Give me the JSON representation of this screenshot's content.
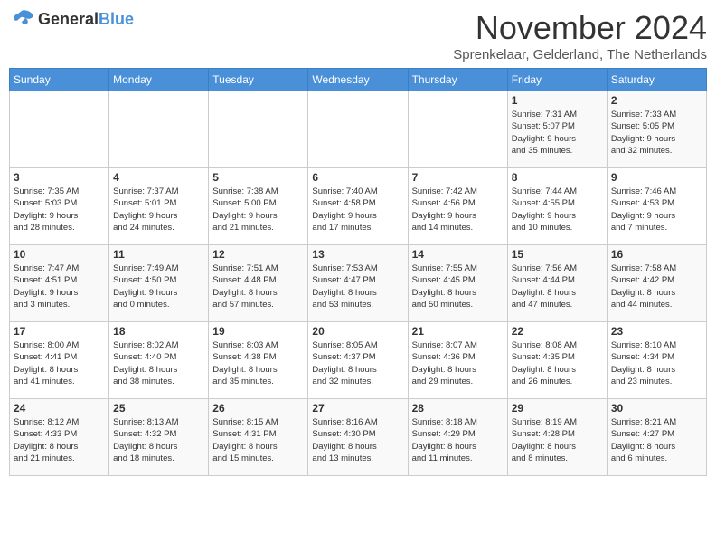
{
  "header": {
    "logo": {
      "general": "General",
      "blue": "Blue"
    },
    "title": "November 2024",
    "subtitle": "Sprenkelaar, Gelderland, The Netherlands"
  },
  "calendar": {
    "days_of_week": [
      "Sunday",
      "Monday",
      "Tuesday",
      "Wednesday",
      "Thursday",
      "Friday",
      "Saturday"
    ],
    "weeks": [
      [
        {
          "day": "",
          "info": ""
        },
        {
          "day": "",
          "info": ""
        },
        {
          "day": "",
          "info": ""
        },
        {
          "day": "",
          "info": ""
        },
        {
          "day": "",
          "info": ""
        },
        {
          "day": "1",
          "info": "Sunrise: 7:31 AM\nSunset: 5:07 PM\nDaylight: 9 hours\nand 35 minutes."
        },
        {
          "day": "2",
          "info": "Sunrise: 7:33 AM\nSunset: 5:05 PM\nDaylight: 9 hours\nand 32 minutes."
        }
      ],
      [
        {
          "day": "3",
          "info": "Sunrise: 7:35 AM\nSunset: 5:03 PM\nDaylight: 9 hours\nand 28 minutes."
        },
        {
          "day": "4",
          "info": "Sunrise: 7:37 AM\nSunset: 5:01 PM\nDaylight: 9 hours\nand 24 minutes."
        },
        {
          "day": "5",
          "info": "Sunrise: 7:38 AM\nSunset: 5:00 PM\nDaylight: 9 hours\nand 21 minutes."
        },
        {
          "day": "6",
          "info": "Sunrise: 7:40 AM\nSunset: 4:58 PM\nDaylight: 9 hours\nand 17 minutes."
        },
        {
          "day": "7",
          "info": "Sunrise: 7:42 AM\nSunset: 4:56 PM\nDaylight: 9 hours\nand 14 minutes."
        },
        {
          "day": "8",
          "info": "Sunrise: 7:44 AM\nSunset: 4:55 PM\nDaylight: 9 hours\nand 10 minutes."
        },
        {
          "day": "9",
          "info": "Sunrise: 7:46 AM\nSunset: 4:53 PM\nDaylight: 9 hours\nand 7 minutes."
        }
      ],
      [
        {
          "day": "10",
          "info": "Sunrise: 7:47 AM\nSunset: 4:51 PM\nDaylight: 9 hours\nand 3 minutes."
        },
        {
          "day": "11",
          "info": "Sunrise: 7:49 AM\nSunset: 4:50 PM\nDaylight: 9 hours\nand 0 minutes."
        },
        {
          "day": "12",
          "info": "Sunrise: 7:51 AM\nSunset: 4:48 PM\nDaylight: 8 hours\nand 57 minutes."
        },
        {
          "day": "13",
          "info": "Sunrise: 7:53 AM\nSunset: 4:47 PM\nDaylight: 8 hours\nand 53 minutes."
        },
        {
          "day": "14",
          "info": "Sunrise: 7:55 AM\nSunset: 4:45 PM\nDaylight: 8 hours\nand 50 minutes."
        },
        {
          "day": "15",
          "info": "Sunrise: 7:56 AM\nSunset: 4:44 PM\nDaylight: 8 hours\nand 47 minutes."
        },
        {
          "day": "16",
          "info": "Sunrise: 7:58 AM\nSunset: 4:42 PM\nDaylight: 8 hours\nand 44 minutes."
        }
      ],
      [
        {
          "day": "17",
          "info": "Sunrise: 8:00 AM\nSunset: 4:41 PM\nDaylight: 8 hours\nand 41 minutes."
        },
        {
          "day": "18",
          "info": "Sunrise: 8:02 AM\nSunset: 4:40 PM\nDaylight: 8 hours\nand 38 minutes."
        },
        {
          "day": "19",
          "info": "Sunrise: 8:03 AM\nSunset: 4:38 PM\nDaylight: 8 hours\nand 35 minutes."
        },
        {
          "day": "20",
          "info": "Sunrise: 8:05 AM\nSunset: 4:37 PM\nDaylight: 8 hours\nand 32 minutes."
        },
        {
          "day": "21",
          "info": "Sunrise: 8:07 AM\nSunset: 4:36 PM\nDaylight: 8 hours\nand 29 minutes."
        },
        {
          "day": "22",
          "info": "Sunrise: 8:08 AM\nSunset: 4:35 PM\nDaylight: 8 hours\nand 26 minutes."
        },
        {
          "day": "23",
          "info": "Sunrise: 8:10 AM\nSunset: 4:34 PM\nDaylight: 8 hours\nand 23 minutes."
        }
      ],
      [
        {
          "day": "24",
          "info": "Sunrise: 8:12 AM\nSunset: 4:33 PM\nDaylight: 8 hours\nand 21 minutes."
        },
        {
          "day": "25",
          "info": "Sunrise: 8:13 AM\nSunset: 4:32 PM\nDaylight: 8 hours\nand 18 minutes."
        },
        {
          "day": "26",
          "info": "Sunrise: 8:15 AM\nSunset: 4:31 PM\nDaylight: 8 hours\nand 15 minutes."
        },
        {
          "day": "27",
          "info": "Sunrise: 8:16 AM\nSunset: 4:30 PM\nDaylight: 8 hours\nand 13 minutes."
        },
        {
          "day": "28",
          "info": "Sunrise: 8:18 AM\nSunset: 4:29 PM\nDaylight: 8 hours\nand 11 minutes."
        },
        {
          "day": "29",
          "info": "Sunrise: 8:19 AM\nSunset: 4:28 PM\nDaylight: 8 hours\nand 8 minutes."
        },
        {
          "day": "30",
          "info": "Sunrise: 8:21 AM\nSunset: 4:27 PM\nDaylight: 8 hours\nand 6 minutes."
        }
      ]
    ]
  }
}
